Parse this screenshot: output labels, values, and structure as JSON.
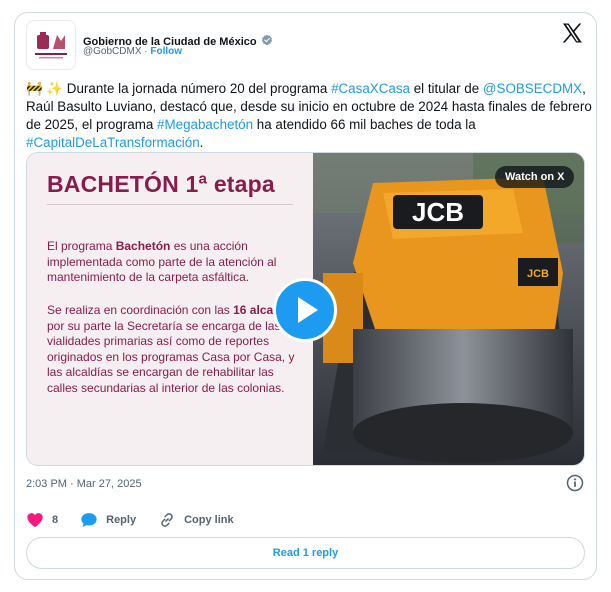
{
  "author": {
    "name": "Gobierno de la Ciudad de México",
    "handle": "@GobCDMX",
    "separator": "·",
    "follow_label": "Follow",
    "verified_color": "#829aab"
  },
  "tweet": {
    "emojis": "🚧 ✨",
    "text_parts": [
      {
        "t": " Durante la jornada número 20 del programa ",
        "link": false
      },
      {
        "t": "#CasaXCasa",
        "link": true
      },
      {
        "t": " el titular de ",
        "link": false
      },
      {
        "t": "@SOBSECDMX",
        "link": true
      },
      {
        "t": ", Raúl Basulto Luviano, destacó que, desde su inicio en octubre de 2024 hasta finales de febrero de 2025, el programa ",
        "link": false
      },
      {
        "t": "#Megabachetón",
        "link": true
      },
      {
        "t": " ha atendido 66 mil baches de toda la ",
        "link": false
      },
      {
        "t": "#CapitalDeLaTransformación",
        "link": true
      },
      {
        "t": ".",
        "link": false
      }
    ]
  },
  "media": {
    "title": "BACHETÓN 1ª etapa",
    "paragraph1": [
      {
        "t": "El programa ",
        "b": false
      },
      {
        "t": "Bachetón",
        "b": true
      },
      {
        "t": " es una acción implementada como parte de la atención al mantenimiento de la carpeta asfáltica.",
        "b": false
      }
    ],
    "paragraph2": [
      {
        "t": "Se realiza en coordinación con las ",
        "b": false
      },
      {
        "t": "16 alcaldías",
        "b": true
      },
      {
        "t": ", por su parte la Secretaría se encarga de las vialidades primarias así como de reportes originados en los programas Casa por Casa, y las alcaldías se encargan de rehabilitar las calles secundarias al interior de las colonias.",
        "b": false
      }
    ],
    "brand_text": "JCB",
    "watch_label": "Watch on X",
    "accent_color": "#8a1c4a"
  },
  "meta": {
    "timestamp": "2:03 PM · Mar 27, 2025"
  },
  "actions": {
    "likes_count": "8",
    "reply_label": "Reply",
    "copy_label": "Copy link"
  },
  "read_replies_label": "Read 1 reply",
  "colors": {
    "link": "#1d9bf0",
    "like": "#f91880",
    "secondary": "#536471"
  }
}
